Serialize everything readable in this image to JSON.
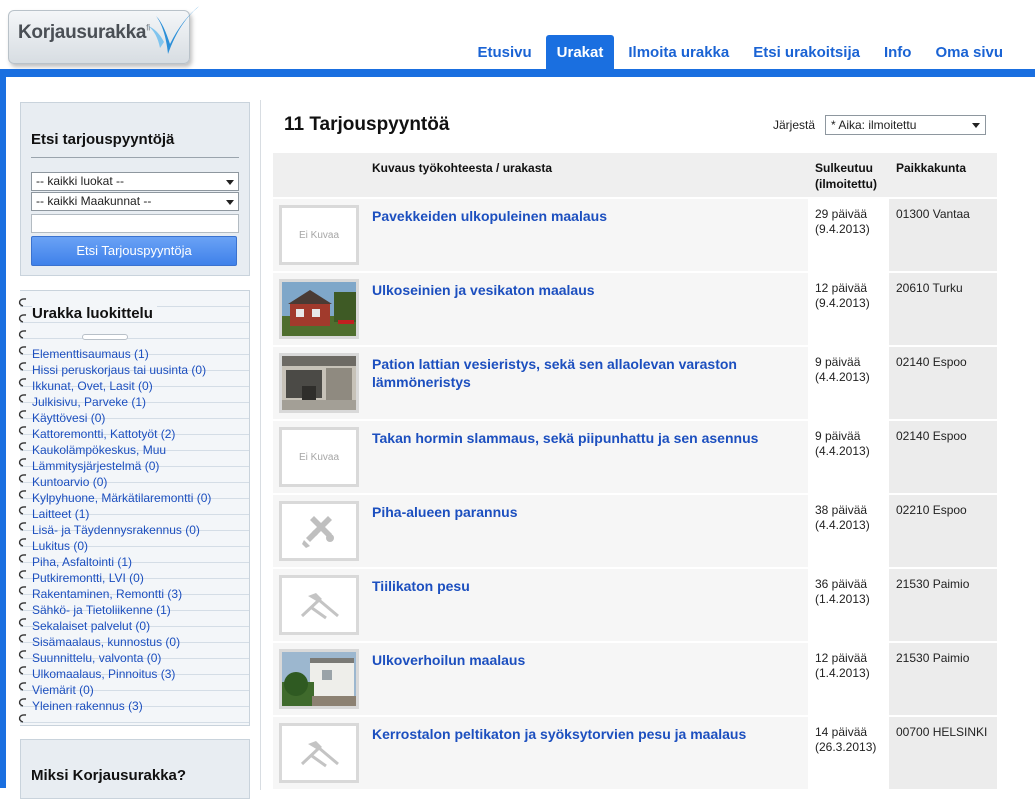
{
  "header": {
    "logo_text": "Korjausurakka",
    "logo_suffix": "fi"
  },
  "nav": [
    {
      "label": "Etusivu",
      "active": false
    },
    {
      "label": "Urakat",
      "active": true
    },
    {
      "label": "Ilmoita urakka",
      "active": false
    },
    {
      "label": "Etsi urakoitsija",
      "active": false
    },
    {
      "label": "Info",
      "active": false
    },
    {
      "label": "Oma sivu",
      "active": false
    }
  ],
  "search": {
    "title": "Etsi tarjouspyyntöjä",
    "category_select": "-- kaikki luokat --",
    "region_select": "-- kaikki Maakunnat --",
    "text_value": "",
    "button_label": "Etsi Tarjouspyyntöja"
  },
  "categories": {
    "title": "Urakka luokittelu",
    "items": [
      "Elementtisaumaus (1)",
      "Hissi peruskorjaus tai uusinta (0)",
      "Ikkunat, Ovet, Lasit (0)",
      "Julkisivu, Parveke (1)",
      "Käyttövesi (0)",
      "Kattoremontti, Kattotyöt (2)",
      "Kaukolämpökeskus, Muu",
      "Lämmitysjärjestelmä (0)",
      "Kuntoarvio (0)",
      "Kylpyhuone, Märkätilaremontti (0)",
      "Laitteet (1)",
      "Lisä- ja Täydennysrakennus (0)",
      "Lukitus (0)",
      "Piha, Asfaltointi (1)",
      "Putkiremontti, LVI (0)",
      "Rakentaminen, Remontti (3)",
      "Sähkö- ja Tietoliikenne (1)",
      "Sekalaiset palvelut (0)",
      "Sisämaalaus, kunnostus (0)",
      "Suunnittelu, valvonta (0)",
      "Ulkomaalaus, Pinnoitus (3)",
      "Viemärit (0)",
      "Yleinen rakennus (3)"
    ]
  },
  "why": {
    "title": "Miksi Korjausurakka?"
  },
  "main": {
    "title": "11 Tarjouspyyntöä",
    "sort_label": "Järjestä",
    "sort_value": "* Aika: ilmoitettu",
    "columns": {
      "description": "Kuvaus työkohteesta / urakasta",
      "closes_line1": "Sulkeutuu",
      "closes_line2": "(ilmoitettu)",
      "location": "Paikkakunta"
    },
    "rows": [
      {
        "title": "Pavekkeiden ulkopuleinen maalaus",
        "closes": "29 päivää",
        "posted": "(9.4.2013)",
        "place": "01300 Vantaa",
        "thumb": "none",
        "thumb_text": "Ei Kuvaa"
      },
      {
        "title": "Ulkoseinien ja vesikaton maalaus",
        "closes": "12 päivää",
        "posted": "(9.4.2013)",
        "place": "20610 Turku",
        "thumb": "photo-red-house",
        "thumb_text": ""
      },
      {
        "title": "Pation lattian vesieristys, sekä sen allaolevan varaston lämmöneristys",
        "closes": "9 päivää",
        "posted": "(4.4.2013)",
        "place": "02140 Espoo",
        "thumb": "photo-patio",
        "thumb_text": ""
      },
      {
        "title": "Takan hormin slammaus, sekä piipunhattu ja sen asennus",
        "closes": "9 päivää",
        "posted": "(4.4.2013)",
        "place": "02140 Espoo",
        "thumb": "none",
        "thumb_text": "Ei Kuvaa"
      },
      {
        "title": "Piha-alueen parannus",
        "closes": "38 päivää",
        "posted": "(4.4.2013)",
        "place": "02210 Espoo",
        "thumb": "tools-icon",
        "thumb_text": ""
      },
      {
        "title": "Tiilikaton pesu",
        "closes": "36 päivää",
        "posted": "(1.4.2013)",
        "place": "21530 Paimio",
        "thumb": "roof-icon",
        "thumb_text": ""
      },
      {
        "title": "Ulkoverhoilun maalaus",
        "closes": "12 päivää",
        "posted": "(1.4.2013)",
        "place": "21530 Paimio",
        "thumb": "photo-white-house",
        "thumb_text": ""
      },
      {
        "title": "Kerrostalon peltikaton ja syöksytorvien pesu ja maalaus",
        "closes": "14 päivää",
        "posted": "(26.3.2013)",
        "place": "00700 HELSINKI",
        "thumb": "roof-icon",
        "thumb_text": ""
      }
    ]
  }
}
